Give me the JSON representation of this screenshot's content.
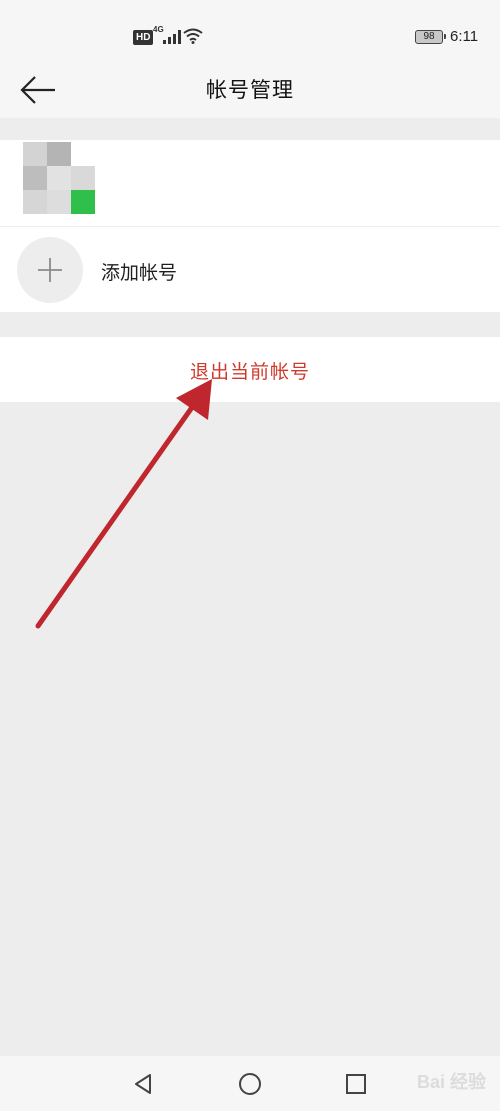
{
  "status_bar": {
    "hd": "HD",
    "network": "4G",
    "battery": "98",
    "time": "6:11",
    "icons": [
      "signal-icon",
      "wifi-icon",
      "battery-icon"
    ]
  },
  "header": {
    "title": "帐号管理",
    "back_icon": "arrow-left-icon"
  },
  "account": {
    "avatar_icon": "pixelated-avatar"
  },
  "add_account": {
    "label": "添加帐号",
    "icon": "plus-icon"
  },
  "logout": {
    "label": "退出当前帐号"
  },
  "nav": {
    "icons": [
      "back-triangle-icon",
      "home-circle-icon",
      "recents-square-icon"
    ]
  },
  "watermark": "Bai 经验",
  "colors": {
    "accent_red": "#d03a2c",
    "annotation_arrow": "#c0262d",
    "avatar_green": "#2ec04a",
    "background": "#ededed"
  }
}
